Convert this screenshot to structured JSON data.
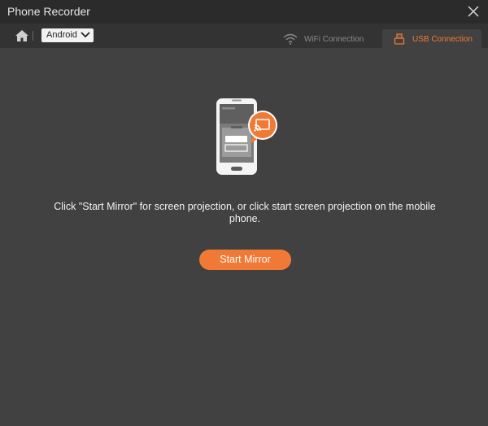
{
  "window": {
    "title": "Phone Recorder"
  },
  "toolbar": {
    "device_select": {
      "selected": "Android"
    },
    "tabs": [
      {
        "label": "WiFi Connection",
        "icon": "wifi-icon",
        "active": false
      },
      {
        "label": "USB Connection",
        "icon": "usb-icon",
        "active": true
      }
    ]
  },
  "main": {
    "illustration_icon": "phone-mirror-icon",
    "instruction": "Click \"Start Mirror\" for screen projection, or click start screen projection on the mobile phone.",
    "start_button_label": "Start Mirror"
  },
  "colors": {
    "accent": "#f07a35",
    "background": "#414141",
    "titlebar": "#2b2b2b",
    "toolbar": "#333333"
  }
}
